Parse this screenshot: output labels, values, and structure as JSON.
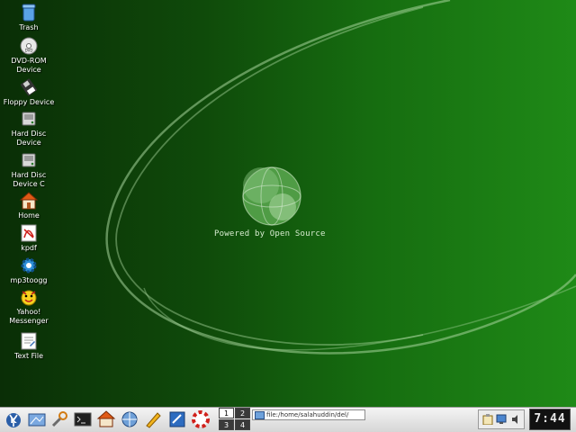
{
  "desktop": {
    "icons": [
      {
        "label": "Trash",
        "icon": "trash-icon"
      },
      {
        "label": "DVD-ROM Device",
        "icon": "dvd-rom-icon"
      },
      {
        "label": "Floppy Device",
        "icon": "floppy-icon"
      },
      {
        "label": "Hard Disc Device",
        "icon": "hard-disc-icon"
      },
      {
        "label": "Hard Disc Device C",
        "icon": "hard-disc-icon"
      },
      {
        "label": "Home",
        "icon": "home-icon"
      },
      {
        "label": "kpdf",
        "icon": "kpdf-icon"
      },
      {
        "label": "mp3toogg",
        "icon": "gear-icon"
      },
      {
        "label": "Yahoo! Messenger",
        "icon": "yahoo-messenger-icon"
      },
      {
        "label": "Text File",
        "icon": "text-file-icon"
      }
    ],
    "wallpaper_text": "Powered by Open Source"
  },
  "taskbar": {
    "launchers": [
      {
        "icon": "kde-menu-icon"
      },
      {
        "icon": "desktop-icon"
      },
      {
        "icon": "tools-icon"
      },
      {
        "icon": "terminal-icon"
      },
      {
        "icon": "home-icon"
      },
      {
        "icon": "network-icon"
      },
      {
        "icon": "editor-icon"
      },
      {
        "icon": "kate-icon"
      },
      {
        "icon": "help-icon"
      }
    ],
    "pager": {
      "desktops": [
        "1",
        "2",
        "3",
        "4"
      ],
      "active": "1"
    },
    "url_bar": {
      "value": "file:/home/salahuddin/del/"
    },
    "tray": [
      {
        "icon": "clipboard-icon"
      },
      {
        "icon": "display-icon"
      },
      {
        "icon": "volume-icon"
      }
    ],
    "clock": "7:44"
  },
  "colors": {
    "wallpaper_dark": "#0a2e06",
    "wallpaper_light": "#1f8a17",
    "taskbar": "#e4e4e4"
  }
}
